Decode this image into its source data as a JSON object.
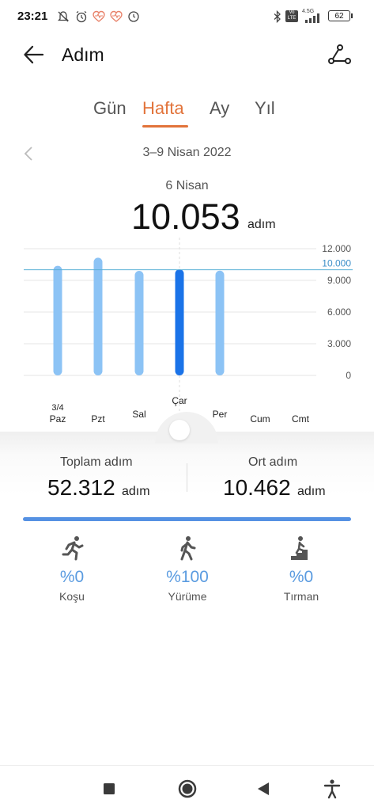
{
  "status_bar": {
    "time": "23:21",
    "network": "4.5G",
    "volte": "Vo LTE",
    "battery": "62"
  },
  "header": {
    "title": "Adım",
    "back_icon": "arrow-left-icon",
    "share_icon": "share-nodes-icon"
  },
  "tabs": [
    {
      "label": "Gün",
      "active": false
    },
    {
      "label": "Hafta",
      "active": true
    },
    {
      "label": "Ay",
      "active": false
    },
    {
      "label": "Yıl",
      "active": false
    }
  ],
  "range": {
    "label": "3–9 Nisan 2022"
  },
  "selected": {
    "date": "6 Nisan",
    "value": "10.053",
    "unit": "adım"
  },
  "colors": {
    "accent": "#e2733a",
    "bar": "#8cc3f5",
    "bar_selected": "#1a73e8",
    "goal_line": "#5ab0d6",
    "progress": "#5591e3"
  },
  "chart_data": {
    "type": "bar",
    "categories": [
      "Paz",
      "Pzt",
      "Sal",
      "Çar",
      "Per",
      "Cum",
      "Cmt"
    ],
    "category_date": "3/4",
    "selected_category": "Çar",
    "values": [
      10380,
      11150,
      9900,
      10053,
      9920,
      0,
      0
    ],
    "goal": 10000,
    "goal_label": "10.000",
    "yticks": [
      "0",
      "3.000",
      "6.000",
      "9.000",
      "12.000"
    ],
    "ytick_values": [
      0,
      3000,
      6000,
      9000,
      12000
    ],
    "ylim": [
      0,
      12000
    ],
    "grid": true
  },
  "stats": {
    "total_label": "Toplam adım",
    "total_value": "52.312",
    "avg_label": "Ort adım",
    "avg_value": "10.462",
    "unit": "adım"
  },
  "progress": {
    "fraction": 1.0
  },
  "activities": [
    {
      "icon": "running-icon",
      "pct": "%0",
      "label": "Koşu"
    },
    {
      "icon": "walking-icon",
      "pct": "%100",
      "label": "Yürüme"
    },
    {
      "icon": "climbing-stairs-icon",
      "pct": "%0",
      "label": "Tırman"
    }
  ],
  "nav_bar": {
    "recents": "square-icon",
    "home": "circle-icon",
    "back": "triangle-back-icon",
    "accessibility": "accessibility-icon"
  }
}
